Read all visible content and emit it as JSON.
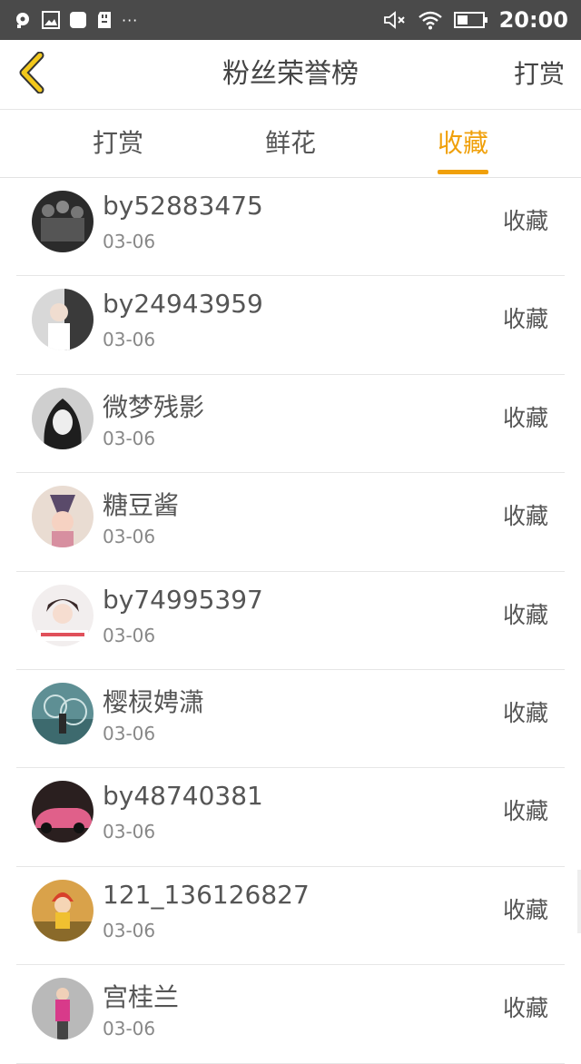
{
  "status_bar": {
    "time": "20:00",
    "overflow": "···",
    "icons": [
      "notification-icon",
      "image-icon",
      "app-icon",
      "sdcard-icon",
      "mute-icon",
      "wifi-icon",
      "battery-icon"
    ]
  },
  "header": {
    "back_icon": "chevron-left-icon",
    "title": "粉丝荣誉榜",
    "action_label": "打赏"
  },
  "tabs": [
    {
      "label": "打赏",
      "active": false
    },
    {
      "label": "鲜花",
      "active": false
    },
    {
      "label": "收藏",
      "active": true
    }
  ],
  "colors": {
    "accent": "#f0a00a",
    "status_bar": "#4a4a4a",
    "text": "#555555",
    "divider": "#e6e6e6"
  },
  "list": [
    {
      "name": "by52883475",
      "date": "03-06",
      "action": "收藏"
    },
    {
      "name": "by24943959",
      "date": "03-06",
      "action": "收藏"
    },
    {
      "name": "微梦残影",
      "date": "03-06",
      "action": "收藏"
    },
    {
      "name": "糖豆酱",
      "date": "03-06",
      "action": "收藏"
    },
    {
      "name": "by74995397",
      "date": "03-06",
      "action": "收藏"
    },
    {
      "name": "樱棂娉潇",
      "date": "03-06",
      "action": "收藏"
    },
    {
      "name": "by48740381",
      "date": "03-06",
      "action": "收藏"
    },
    {
      "name": "121_136126827",
      "date": "03-06",
      "action": "收藏"
    },
    {
      "name": "宫桂兰",
      "date": "03-06",
      "action": "收藏"
    }
  ]
}
